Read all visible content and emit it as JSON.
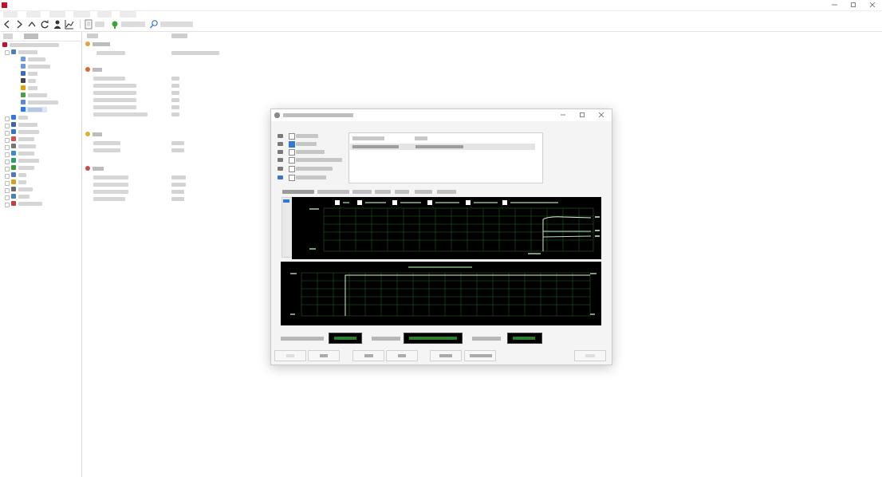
{
  "app": {
    "title": "",
    "menu": [
      "",
      "",
      "",
      "",
      "",
      ""
    ]
  },
  "toolbar": {
    "report_label": "",
    "bios_updates_label": "",
    "driver_updates_label": ""
  },
  "sidebar": {
    "tabs": [
      "",
      ""
    ],
    "items": [
      {
        "label": "",
        "icon": "computer-icon"
      },
      {
        "label": "",
        "icon": "motherboard-icon"
      },
      {
        "label": "",
        "icon": "summary-icon"
      },
      {
        "label": "",
        "icon": "computer-name-icon"
      },
      {
        "label": "",
        "icon": "dmi-icon"
      },
      {
        "label": "",
        "icon": "it-icon"
      },
      {
        "label": "",
        "icon": "overclock-icon"
      },
      {
        "label": "",
        "icon": "power-icon"
      },
      {
        "label": "",
        "icon": "portable-icon"
      },
      {
        "label": "",
        "icon": "sensor-icon"
      },
      {
        "label": "",
        "icon": "os-icon"
      },
      {
        "label": "",
        "icon": "server-icon"
      },
      {
        "label": "",
        "icon": "display-icon"
      },
      {
        "label": "",
        "icon": "multimedia-icon"
      },
      {
        "label": "",
        "icon": "storage-icon"
      },
      {
        "label": "",
        "icon": "network-icon"
      },
      {
        "label": "",
        "icon": "directx-icon"
      },
      {
        "label": "",
        "icon": "devices-icon"
      },
      {
        "label": "",
        "icon": "software-icon"
      },
      {
        "label": "",
        "icon": "security-icon"
      },
      {
        "label": "",
        "icon": "config-icon"
      },
      {
        "label": "",
        "icon": "database-icon"
      },
      {
        "label": "",
        "icon": "benchmark-icon"
      }
    ]
  },
  "main": {
    "columns": [
      "",
      ""
    ],
    "groups": [
      {
        "title": "",
        "rows": [
          {
            "field": "",
            "value": ""
          }
        ]
      },
      {
        "title": "",
        "rows": [
          {
            "field": "",
            "value": ""
          },
          {
            "field": "",
            "value": ""
          },
          {
            "field": "",
            "value": ""
          },
          {
            "field": "",
            "value": ""
          },
          {
            "field": "",
            "value": ""
          },
          {
            "field": "",
            "value": ""
          }
        ]
      },
      {
        "title": "",
        "rows": [
          {
            "field": "",
            "value": ""
          },
          {
            "field": "",
            "value": ""
          }
        ]
      },
      {
        "title": "",
        "rows": [
          {
            "field": "",
            "value": ""
          },
          {
            "field": "",
            "value": ""
          },
          {
            "field": "",
            "value": ""
          },
          {
            "field": "",
            "value": ""
          }
        ]
      }
    ]
  },
  "dialog": {
    "title": "",
    "options": [
      {
        "label": "",
        "checked": false,
        "icon": "cpu-icon"
      },
      {
        "label": "",
        "checked": true,
        "icon": "fpu-icon"
      },
      {
        "label": "",
        "checked": false,
        "icon": "cache-icon"
      },
      {
        "label": "",
        "checked": false,
        "icon": "memory-icon"
      },
      {
        "label": "",
        "checked": false,
        "icon": "disk-icon"
      },
      {
        "label": "",
        "checked": false,
        "icon": "gpu-icon"
      }
    ],
    "log_columns": [
      "",
      ""
    ],
    "log_rows": [
      {
        "datetime": "",
        "status": ""
      }
    ],
    "tabs": [
      "",
      "",
      "",
      "",
      "",
      "",
      ""
    ],
    "active_tab": 0,
    "status": {
      "battery_label": "",
      "battery_value": "",
      "start_label": "",
      "start_value": "",
      "elapsed_label": "",
      "elapsed_value": ""
    },
    "buttons": [
      {
        "label": "",
        "enabled": false
      },
      {
        "label": "",
        "enabled": true
      },
      {
        "label": "",
        "enabled": true
      },
      {
        "label": "",
        "enabled": true
      },
      {
        "label": "",
        "enabled": true
      },
      {
        "label": "",
        "enabled": true
      },
      {
        "label": "",
        "enabled": false
      }
    ]
  },
  "colors": {
    "accent": "#2f7ad8",
    "chart_background": "#000000",
    "chart_grid": "#1f6b1f",
    "chart_line": "#cfe8cf",
    "brand": "#c8102e"
  }
}
